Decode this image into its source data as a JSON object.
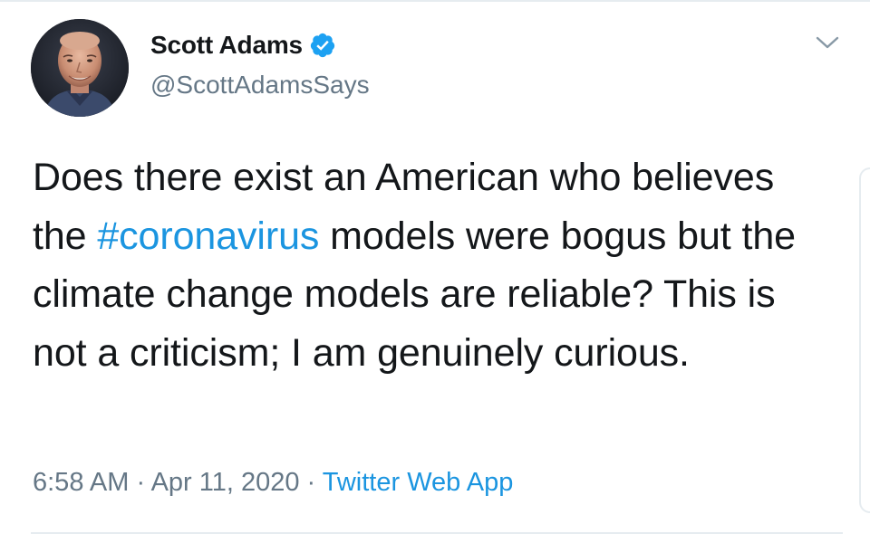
{
  "user": {
    "display_name": "Scott Adams",
    "handle": "@ScottAdamsSays",
    "verified": true,
    "avatar_icon": "profile-photo"
  },
  "tweet": {
    "text_before_hashtag": "Does there exist an American who believes the ",
    "hashtag": "#coronavirus",
    "text_after_hashtag": " models were bogus but the climate change models are reliable? This is not a criticism; I am genuinely curious."
  },
  "meta": {
    "time": "6:58 AM",
    "separator": " · ",
    "date": "Apr 11, 2020",
    "source": "Twitter Web App"
  },
  "icons": {
    "verified": "verified-badge-icon",
    "menu": "chevron-down-icon"
  },
  "colors": {
    "text": "#14171a",
    "secondary": "#657786",
    "link": "#1b95e0",
    "verified": "#1da1f2",
    "border": "#e6ecf0"
  }
}
